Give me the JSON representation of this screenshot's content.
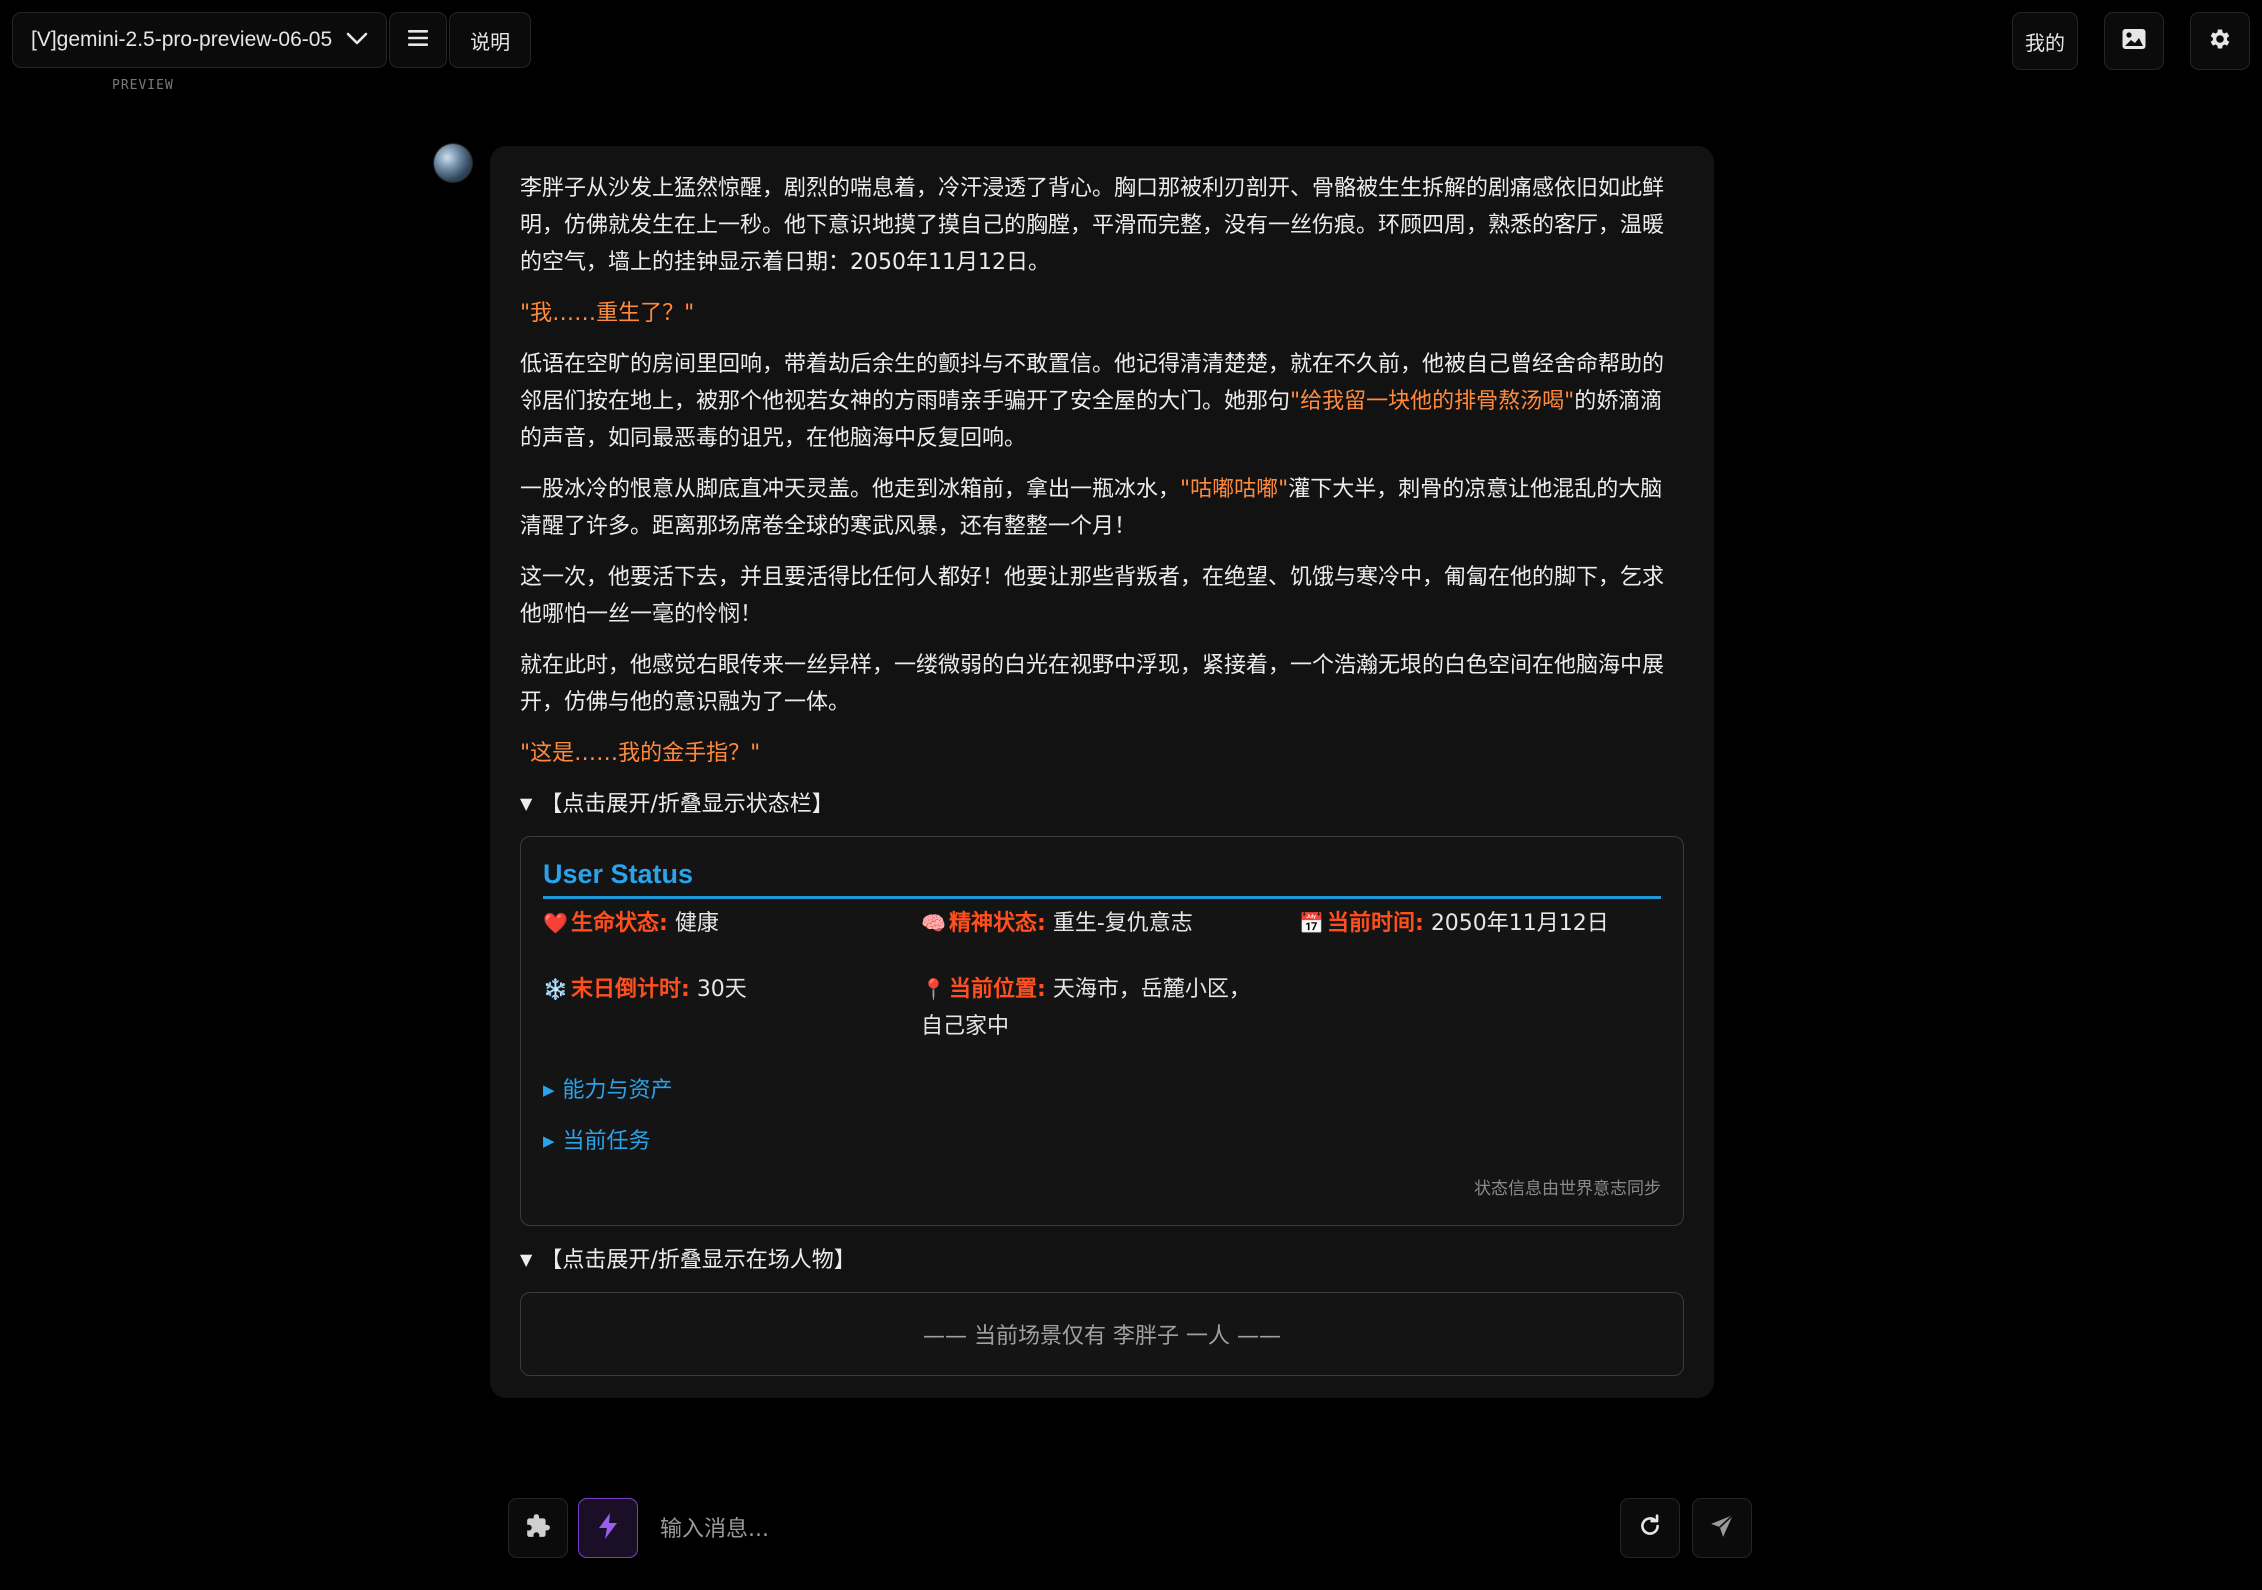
{
  "header": {
    "model_label": "[V]gemini-2.5-pro-preview-06-05",
    "preview_tag": "PREVIEW",
    "help_label": "说明",
    "mine_label": "我的"
  },
  "message": {
    "paragraphs": [
      [
        {
          "t": "李胖子从沙发上猛然惊醒，剧烈的喘息着，冷汗浸透了背心。胸口那被利刃剖开、骨骼被生生拆解的剧痛感依旧如此鲜明，仿佛就发生在上一秒。他下意识地摸了摸自己的胸膛，平滑而完整，没有一丝伤痕。环顾四周，熟悉的客厅，温暖的空气，墙上的挂钟显示着日期：2050年11月12日。"
        }
      ],
      [
        {
          "t": "\"我……重生了？\"",
          "q": true
        }
      ],
      [
        {
          "t": "低语在空旷的房间里回响，带着劫后余生的颤抖与不敢置信。他记得清清楚楚，就在不久前，他被自己曾经舍命帮助的邻居们按在地上，被那个他视若女神的方雨晴亲手骗开了安全屋的大门。她那句"
        },
        {
          "t": "\"给我留一块他的排骨熬汤喝\"",
          "q": true
        },
        {
          "t": "的娇滴滴的声音，如同最恶毒的诅咒，在他脑海中反复回响。"
        }
      ],
      [
        {
          "t": "一股冰冷的恨意从脚底直冲天灵盖。他走到冰箱前，拿出一瓶冰水，"
        },
        {
          "t": "\"咕嘟咕嘟\"",
          "q": true
        },
        {
          "t": "灌下大半，刺骨的凉意让他混乱的大脑清醒了许多。距离那场席卷全球的寒武风暴，还有整整一个月！"
        }
      ],
      [
        {
          "t": "这一次，他要活下去，并且要活得比任何人都好！他要让那些背叛者，在绝望、饥饿与寒冷中，匍匐在他的脚下，乞求他哪怕一丝一毫的怜悯！"
        }
      ],
      [
        {
          "t": "就在此时，他感觉右眼传来一丝异样，一缕微弱的白光在视野中浮现，紧接着，一个浩瀚无垠的白色空间在他脑海中展开，仿佛与他的意识融为了一体。"
        }
      ],
      [
        {
          "t": "\"这是……我的金手指？\"",
          "q": true
        }
      ]
    ],
    "status_toggle": "【点击展开/折叠显示状态栏】",
    "status": {
      "title": "User Status",
      "fields": [
        {
          "icon": "heart-icon",
          "glyph": "❤️",
          "label": "生命状态:",
          "value": "健康"
        },
        {
          "icon": "brain-icon",
          "glyph": "🧠",
          "label": "精神状态:",
          "value": "重生-复仇意志"
        },
        {
          "icon": "calendar-icon",
          "glyph": "📅",
          "label": "当前时间:",
          "value": "2050年11月12日"
        },
        {
          "icon": "snowflake-icon",
          "glyph": "❄️",
          "label": "末日倒计时:",
          "value": "30天"
        },
        {
          "icon": "pin-icon",
          "glyph": "📍",
          "label": "当前位置:",
          "value": "天海市，岳麓小区，自己家中"
        }
      ],
      "abilities_toggle": "能力与资产",
      "tasks_toggle": "当前任务",
      "sync_note": "状态信息由世界意志同步"
    },
    "characters_toggle": "【点击展开/折叠显示在场人物】",
    "scene_note": "—— 当前场景仅有 李胖子 一人 ——"
  },
  "input": {
    "placeholder": "输入消息..."
  },
  "colors": {
    "accent_blue": "#2aa3ea",
    "quote_orange": "#ff8a3d",
    "label_red": "#ff4f1f",
    "bolt_purple": "#9b5cf0"
  }
}
